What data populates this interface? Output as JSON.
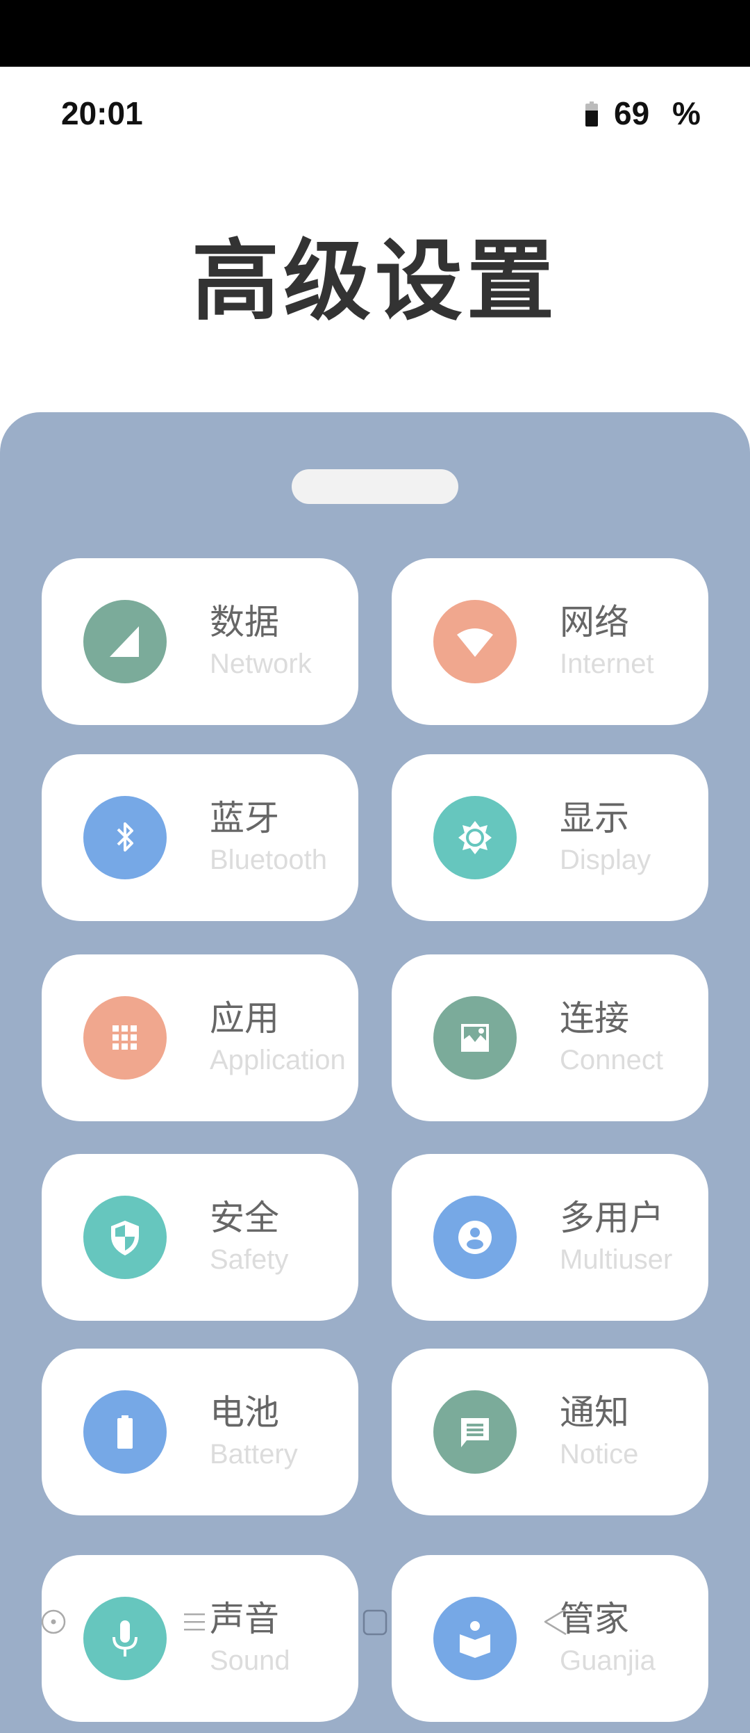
{
  "status_bar": {
    "time": "20:01",
    "battery_level": 0.69,
    "battery_text": "69",
    "battery_unit": "%"
  },
  "page": {
    "title": "高级设置"
  },
  "colors": {
    "panel": "#9BAEC8",
    "green": "#7BAB9A",
    "salmon": "#F0A78E",
    "blue": "#76A8E6",
    "teal": "#66C6BE"
  },
  "settings": [
    {
      "label": "数据",
      "sub": "Network",
      "icon": "signal-icon",
      "color": "#7BAB9A"
    },
    {
      "label": "网络",
      "sub": "Internet",
      "icon": "wifi-icon",
      "color": "#F0A78E"
    },
    {
      "label": "蓝牙",
      "sub": "Bluetooth",
      "icon": "bluetooth-icon",
      "color": "#76A8E6"
    },
    {
      "label": "显示",
      "sub": "Display",
      "icon": "brightness-icon",
      "color": "#66C6BE"
    },
    {
      "label": "应用",
      "sub": "Application",
      "icon": "apps-grid-icon",
      "color": "#F0A78E"
    },
    {
      "label": "连接",
      "sub": "Connect",
      "icon": "image-icon",
      "color": "#7BAB9A"
    },
    {
      "label": "安全",
      "sub": "Safety",
      "icon": "shield-icon",
      "color": "#66C6BE"
    },
    {
      "label": "多用户",
      "sub": "Multiuser",
      "icon": "user-icon",
      "color": "#76A8E6"
    },
    {
      "label": "电池",
      "sub": "Battery",
      "icon": "battery-icon",
      "color": "#76A8E6"
    },
    {
      "label": "通知",
      "sub": "Notice",
      "icon": "message-icon",
      "color": "#7BAB9A"
    },
    {
      "label": "声音",
      "sub": "Sound",
      "icon": "microphone-icon",
      "color": "#66C6BE"
    },
    {
      "label": "管家",
      "sub": "Guanjia",
      "icon": "book-reader-icon",
      "color": "#76A8E6"
    }
  ],
  "nav": {
    "buttons": [
      "assistant",
      "menu",
      "home",
      "back"
    ]
  }
}
